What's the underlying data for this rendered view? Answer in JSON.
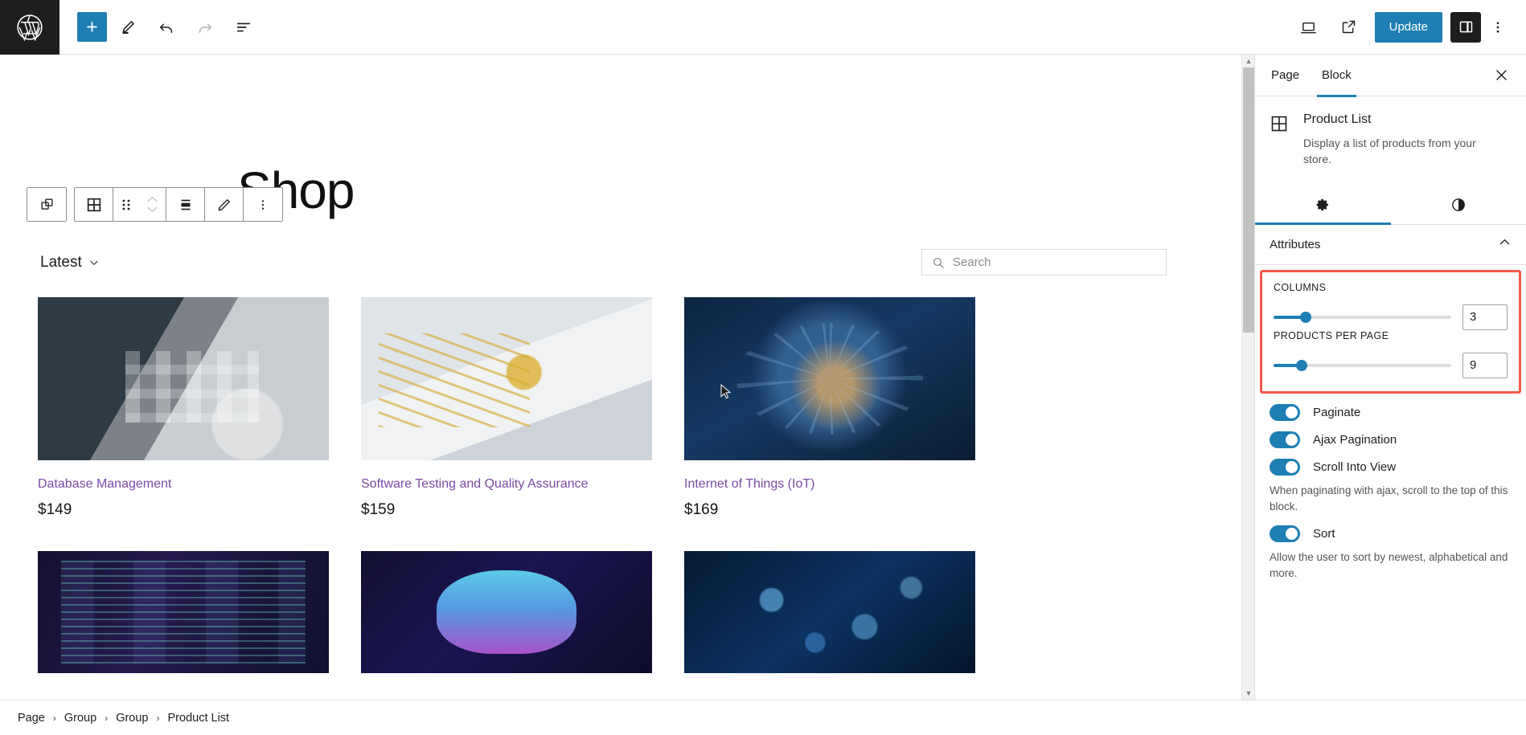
{
  "topbar": {
    "logo_icon": "wordpress-logo",
    "tools": [
      {
        "name": "add-block-button",
        "icon": "plus-icon",
        "label": "Add block"
      },
      {
        "name": "edit-tool-button",
        "icon": "pencil-icon",
        "label": "Tools"
      },
      {
        "name": "undo-button",
        "icon": "undo-arrow-icon",
        "label": "Undo"
      },
      {
        "name": "redo-button",
        "icon": "redo-arrow-icon",
        "label": "Redo"
      },
      {
        "name": "list-view-button",
        "icon": "document-overview-icon",
        "label": "Document Overview"
      }
    ],
    "right_tools": [
      {
        "name": "view-device-button",
        "icon": "desktop-icon",
        "label": "View"
      },
      {
        "name": "preview-external-button",
        "icon": "external-link-icon",
        "label": "Preview in new tab"
      }
    ],
    "update_label": "Update",
    "settings_label": "Settings",
    "options_label": "Options"
  },
  "canvas": {
    "page_title": "Shop",
    "block_toolbar": [
      {
        "name": "select-parent-block-button",
        "icon": "parent-block-icon"
      },
      {
        "name": "block-type-button",
        "icon": "grid-block-icon"
      },
      {
        "name": "drag-handle",
        "icon": "drag-dots-icon"
      },
      {
        "name": "move-up-down-buttons",
        "icon": "chevron-up-down-icon"
      },
      {
        "name": "align-button",
        "icon": "align-center-icon"
      },
      {
        "name": "edit-button",
        "icon": "pencil-edit-icon"
      },
      {
        "name": "more-options-button",
        "icon": "vertical-dots-icon"
      }
    ],
    "sort_label": "Latest",
    "search": {
      "placeholder": "Search",
      "value": "",
      "icon": "search-icon"
    },
    "products": [
      {
        "title": "Database Management",
        "price": "$149",
        "art": "img-desk",
        "row": 1
      },
      {
        "title": "Software Testing and Quality Assurance",
        "price": "$159",
        "art": "img-laptop",
        "row": 1
      },
      {
        "title": "Internet of Things (IoT)",
        "price": "$169",
        "art": "img-iot",
        "row": 1
      },
      {
        "title": "",
        "price": "",
        "art": "img-code",
        "row": 2
      },
      {
        "title": "",
        "price": "",
        "art": "img-cloud",
        "row": 2
      },
      {
        "title": "",
        "price": "",
        "art": "img-bokeh",
        "row": 2
      }
    ]
  },
  "sidebar": {
    "tabs": [
      {
        "label": "Page",
        "active": false
      },
      {
        "label": "Block",
        "active": true
      }
    ],
    "close_label": "Close Settings",
    "block": {
      "icon": "grid-block-icon",
      "name": "Product List",
      "description": "Display a list of products from your store."
    },
    "icon_tabs": [
      {
        "name": "settings-tab",
        "icon": "gear-icon",
        "active": true
      },
      {
        "name": "styles-tab",
        "icon": "contrast-half-circle-icon",
        "active": false
      }
    ],
    "panel": {
      "title": "Attributes",
      "collapse_icon": "chevron-up-icon",
      "expanded": true
    },
    "highlight_color": "#f4594b",
    "accent_color": "#1d7fb3",
    "fields": [
      {
        "label": "COLUMNS",
        "value": "3",
        "slider_pct": 18,
        "name": "columns"
      },
      {
        "label": "PRODUCTS PER PAGE",
        "value": "9",
        "slider_pct": 16,
        "name": "products-per-page"
      }
    ],
    "toggles": [
      {
        "label": "Paginate",
        "on": true,
        "help": ""
      },
      {
        "label": "Ajax Pagination",
        "on": true,
        "help": ""
      },
      {
        "label": "Scroll Into View",
        "on": true,
        "help": "When paginating with ajax, scroll to the top of this block."
      },
      {
        "label": "Sort",
        "on": true,
        "help": "Allow the user to sort by newest, alphabetical and more."
      }
    ]
  },
  "breadcrumb": {
    "separator": "›",
    "items": [
      "Page",
      "Group",
      "Group",
      "Product List"
    ]
  }
}
